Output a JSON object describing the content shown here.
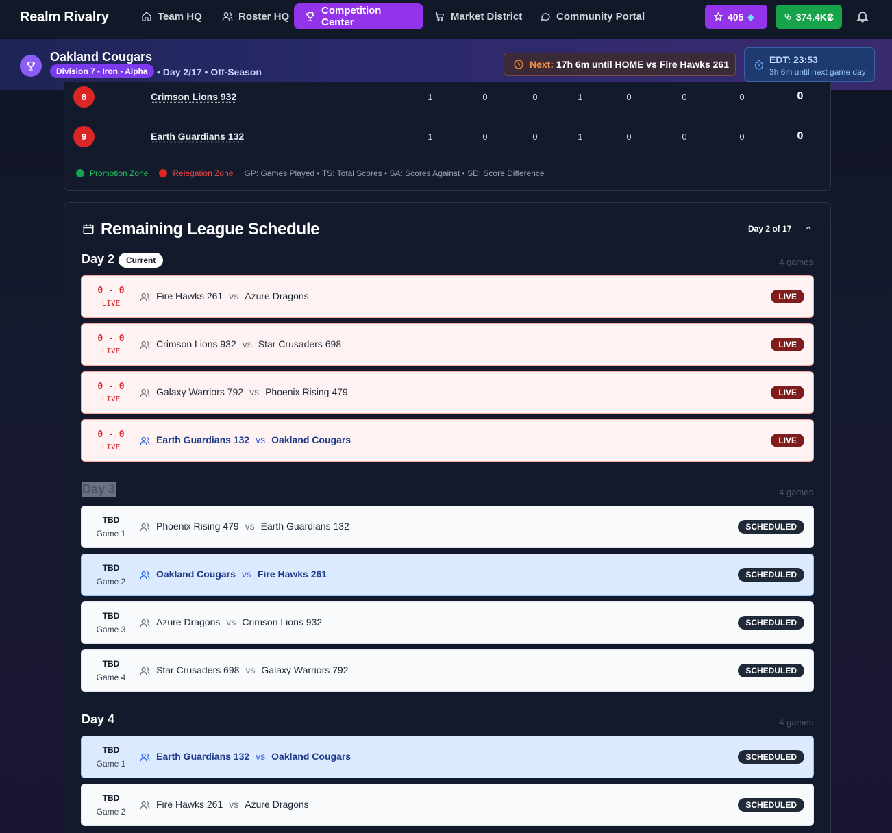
{
  "app": {
    "brand": "Realm Rivalry",
    "nav": [
      {
        "label": "Team HQ",
        "icon": "home-icon"
      },
      {
        "label": "Roster HQ",
        "icon": "users-icon"
      },
      {
        "label": "Competition Center",
        "icon": "trophy-icon",
        "active": true
      },
      {
        "label": "Market District",
        "icon": "cart-icon"
      },
      {
        "label": "Community Portal",
        "icon": "chat-icon"
      }
    ],
    "gems": "405",
    "credits": "374.4K₡",
    "colors": {
      "accent": "#9333ea",
      "gems": "#9333ea",
      "credits": "#16a34a"
    }
  },
  "team": {
    "name": "Oakland Cougars",
    "division": "Division 7 - Iron - Alpha",
    "day": "Day 2/17",
    "season": "Off-Season",
    "next_label": "Next:",
    "next_text": "17h 6m until HOME vs Fire Hawks 261",
    "edt_time": "EDT: 23:53",
    "edt_sub": "3h 6m until next game day"
  },
  "standings": {
    "rows": [
      {
        "rank": "8",
        "team": "Crimson Lions 932",
        "cells": [
          "1",
          "0",
          "0",
          "1",
          "0",
          "0",
          "0"
        ],
        "pts": "0"
      },
      {
        "rank": "9",
        "team": "Earth Guardians 132",
        "cells": [
          "1",
          "0",
          "0",
          "1",
          "0",
          "0",
          "0"
        ],
        "pts": "0"
      }
    ],
    "legend": {
      "promotion": "Promotion Zone",
      "relegation": "Relegation Zone",
      "abbrev": "GP: Games Played • TS: Total Scores • SA: Scores Against • SD: Score Difference"
    }
  },
  "schedule": {
    "title": "Remaining League Schedule",
    "day_indicator": "Day 2 of 17",
    "days": [
      {
        "label": "Day 2",
        "badge": "Current",
        "count": "4 games",
        "games": [
          {
            "score": "0 - 0",
            "state": "LIVE",
            "home": "Fire Hawks 261",
            "away": "Azure Dragons",
            "status": "LIVE",
            "mine": false
          },
          {
            "score": "0 - 0",
            "state": "LIVE",
            "home": "Crimson Lions 932",
            "away": "Star Crusaders 698",
            "status": "LIVE",
            "mine": false
          },
          {
            "score": "0 - 0",
            "state": "LIVE",
            "home": "Galaxy Warriors 792",
            "away": "Phoenix Rising 479",
            "status": "LIVE",
            "mine": false
          },
          {
            "score": "0 - 0",
            "state": "LIVE",
            "home": "Earth Guardians 132",
            "away": "Oakland Cougars",
            "status": "LIVE",
            "mine": true
          }
        ]
      },
      {
        "label": "Day 3",
        "count": "4 games",
        "games": [
          {
            "top": "TBD",
            "num": "Game 1",
            "home": "Phoenix Rising 479",
            "away": "Earth Guardians 132",
            "status": "SCHEDULED",
            "mine": false
          },
          {
            "top": "TBD",
            "num": "Game 2",
            "home": "Oakland Cougars",
            "away": "Fire Hawks 261",
            "status": "SCHEDULED",
            "mine": true
          },
          {
            "top": "TBD",
            "num": "Game 3",
            "home": "Azure Dragons",
            "away": "Crimson Lions 932",
            "status": "SCHEDULED",
            "mine": false
          },
          {
            "top": "TBD",
            "num": "Game 4",
            "home": "Star Crusaders 698",
            "away": "Galaxy Warriors 792",
            "status": "SCHEDULED",
            "mine": false
          }
        ]
      },
      {
        "label": "Day 4",
        "count": "4 games",
        "games": [
          {
            "top": "TBD",
            "num": "Game 1",
            "home": "Earth Guardians 132",
            "away": "Oakland Cougars",
            "status": "SCHEDULED",
            "mine": true
          },
          {
            "top": "TBD",
            "num": "Game 2",
            "home": "Fire Hawks 261",
            "away": "Azure Dragons",
            "status": "SCHEDULED",
            "mine": false
          }
        ]
      }
    ],
    "vs": "vs"
  }
}
